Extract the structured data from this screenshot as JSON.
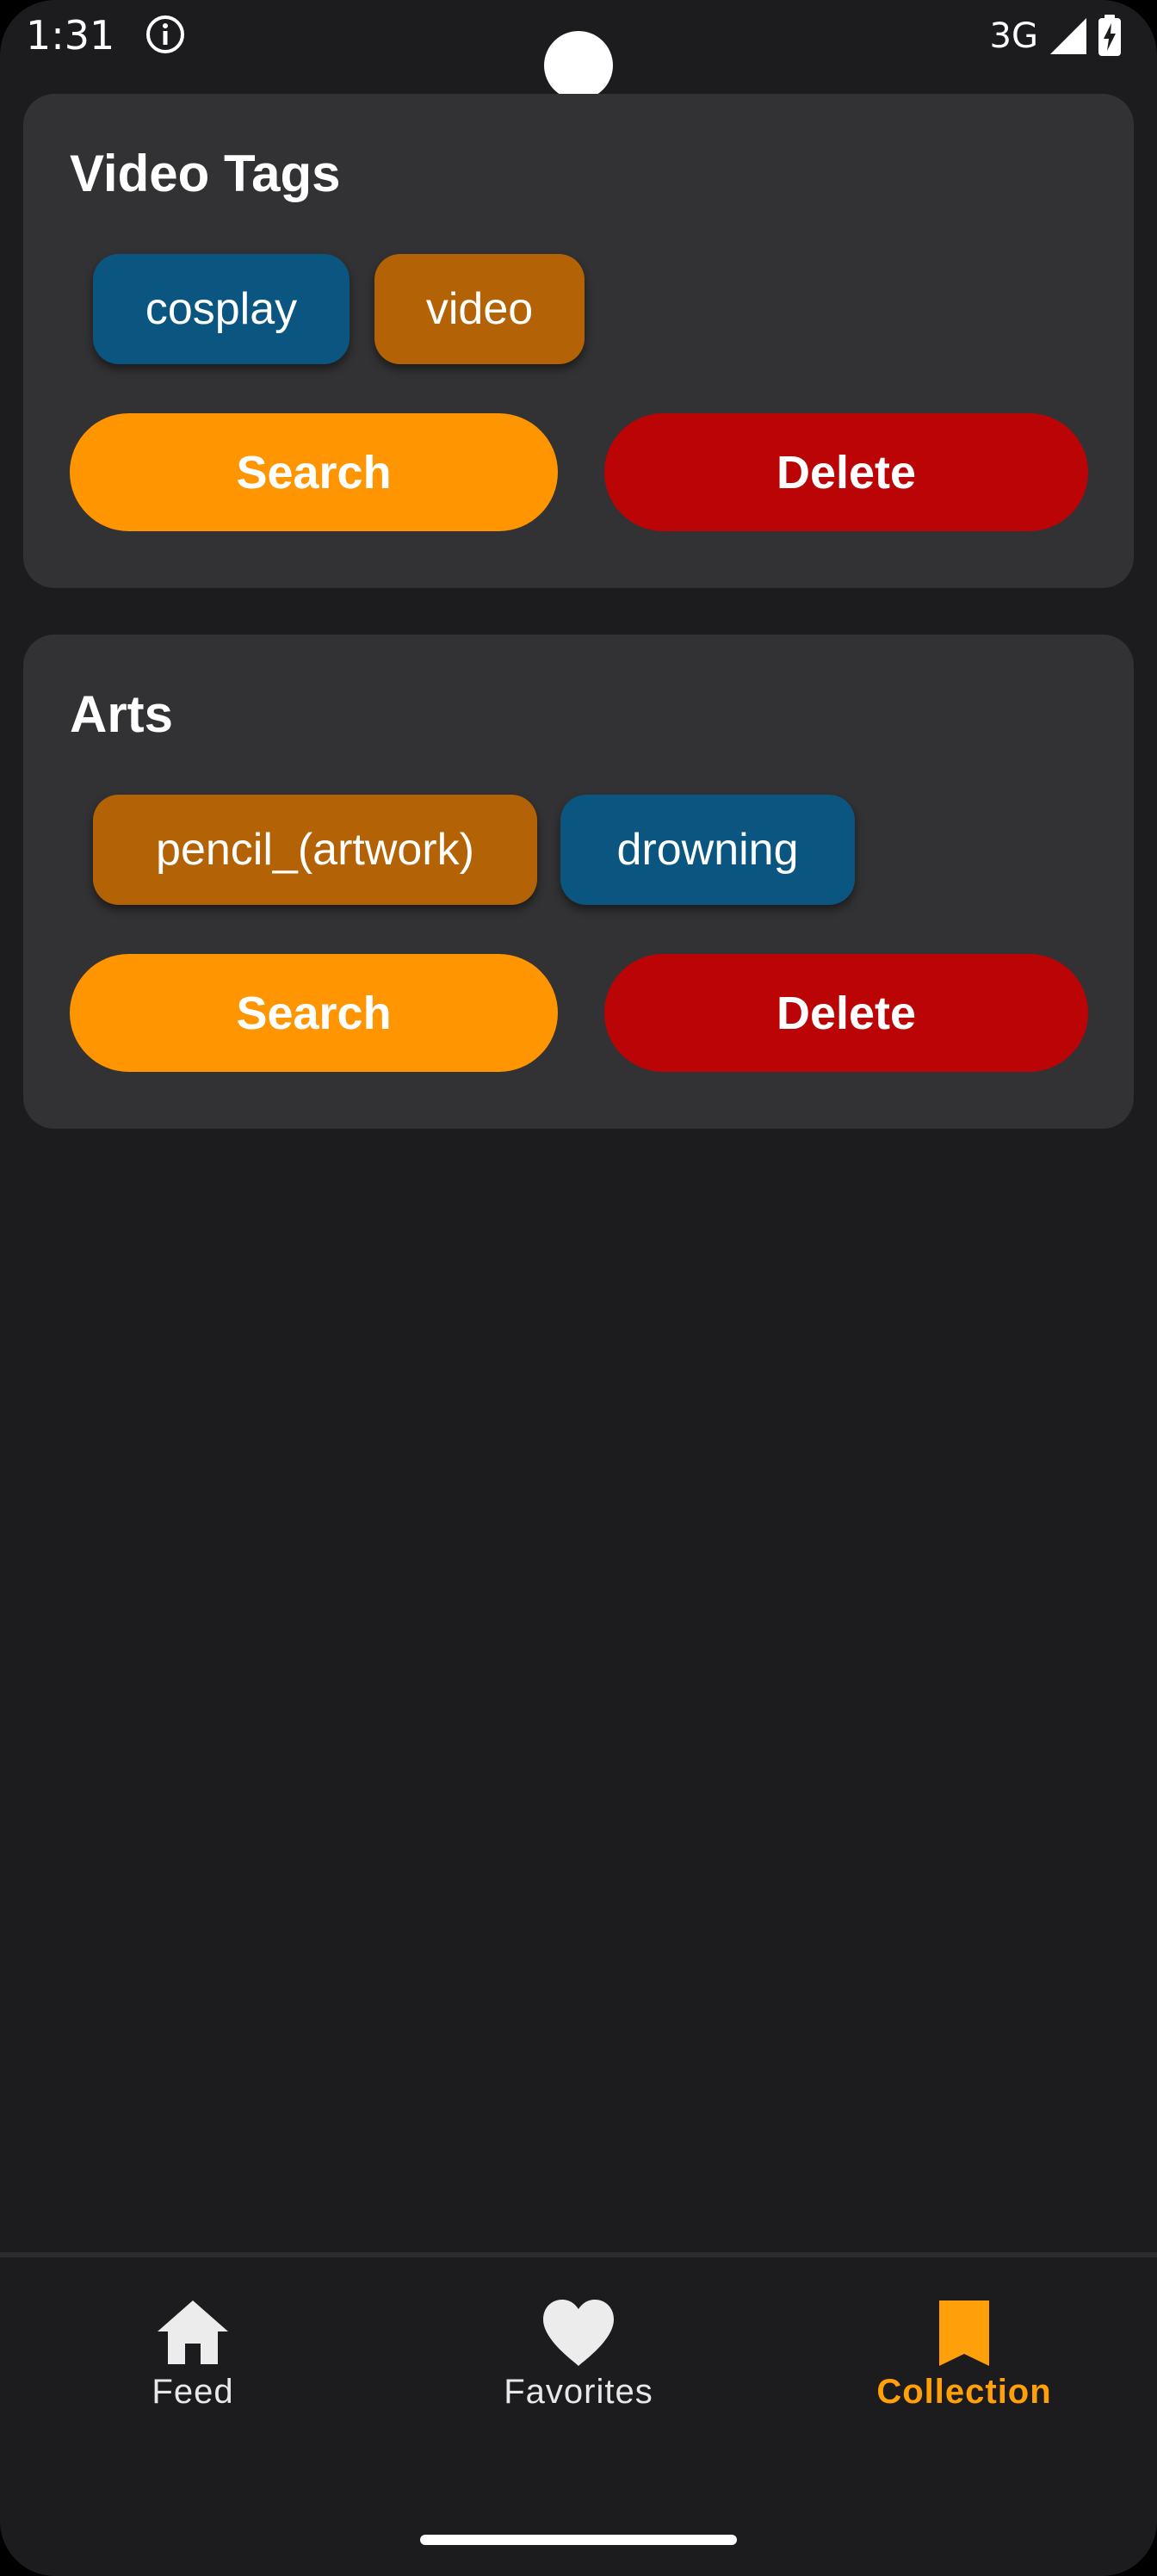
{
  "status_bar": {
    "time": "1:31",
    "network": "3G",
    "icons": [
      "info-icon",
      "cell-signal-icon",
      "battery-charging-icon"
    ]
  },
  "collections": [
    {
      "title": "Video Tags",
      "tags": [
        {
          "label": "cosplay",
          "color": "#0b5681"
        },
        {
          "label": "video",
          "color": "#b36305"
        }
      ],
      "search_label": "Search",
      "delete_label": "Delete"
    },
    {
      "title": "Arts",
      "tags": [
        {
          "label": "pencil_(artwork)",
          "color": "#b36305"
        },
        {
          "label": "drowning",
          "color": "#0b5681"
        }
      ],
      "search_label": "Search",
      "delete_label": "Delete"
    }
  ],
  "bottom_nav": {
    "items": [
      {
        "label": "Feed",
        "icon": "home-icon",
        "active": false
      },
      {
        "label": "Favorites",
        "icon": "heart-icon",
        "active": false
      },
      {
        "label": "Collection",
        "icon": "bookmark-icon",
        "active": true
      }
    ]
  },
  "colors": {
    "background": "#1c1c1e",
    "card": "#323234",
    "accent": "#ff9f0a",
    "search_button": "#ff9500",
    "delete_button": "#bb0406"
  }
}
